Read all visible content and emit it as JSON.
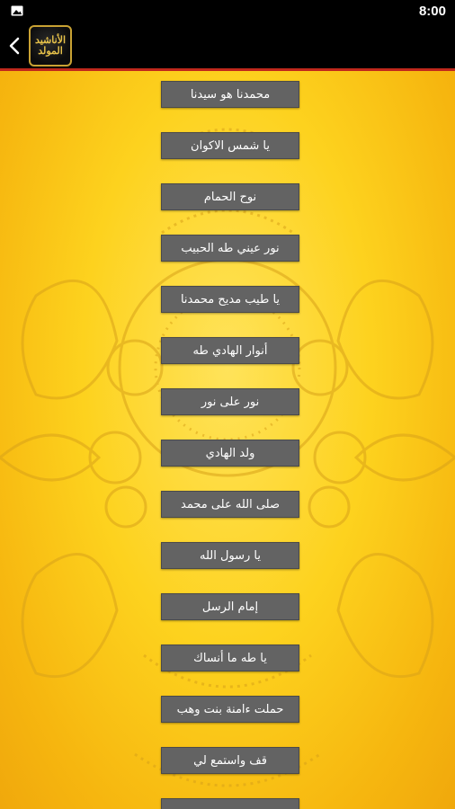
{
  "status_bar": {
    "time": "8:00",
    "icon": "image-icon"
  },
  "app_bar": {
    "back_icon": "chevron-left-icon",
    "logo_text": "الأناشيد المولد"
  },
  "colors": {
    "accent_divider": "#c0281c",
    "button_bg": "#636363",
    "background_yellow": "#fdd21e"
  },
  "items": [
    {
      "label": "محمدنا هو سيدنا"
    },
    {
      "label": "يا شمس الاكوان"
    },
    {
      "label": "نوح الحمام"
    },
    {
      "label": "نور عيني طه الحبيب"
    },
    {
      "label": "يا طيب مديح محمدنا"
    },
    {
      "label": "أنوار الهادي طه"
    },
    {
      "label": "نور على نور"
    },
    {
      "label": "ولد الهادي"
    },
    {
      "label": "صلى الله على محمد"
    },
    {
      "label": "يا رسول الله"
    },
    {
      "label": "إمام الرسل"
    },
    {
      "label": "يا طه ما أنساك"
    },
    {
      "label": "حملت ءامنة بنت وهب"
    },
    {
      "label": "قف واستمع لي"
    },
    {
      "label": ""
    }
  ]
}
